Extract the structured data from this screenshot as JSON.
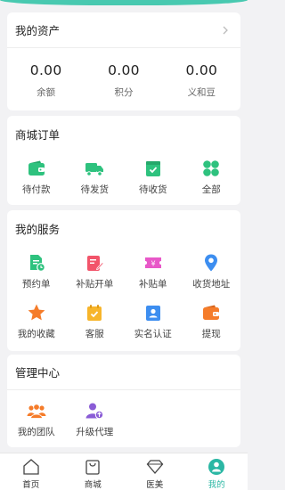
{
  "assets": {
    "title": "我的资产",
    "items": [
      {
        "value": "0.00",
        "label": "余额"
      },
      {
        "value": "0.00",
        "label": "积分"
      },
      {
        "value": "0.00",
        "label": "义和豆"
      }
    ]
  },
  "orders": {
    "title": "商城订单",
    "items": [
      {
        "label": "待付款",
        "icon": "wallet-icon"
      },
      {
        "label": "待发货",
        "icon": "truck-icon"
      },
      {
        "label": "待收货",
        "icon": "receive-box-icon"
      },
      {
        "label": "全部",
        "icon": "all-grid-icon"
      }
    ]
  },
  "services": {
    "title": "我的服务",
    "items": [
      {
        "label": "预约单",
        "icon": "appointment-doc-icon"
      },
      {
        "label": "补贴开单",
        "icon": "subsidy-order-edit-icon"
      },
      {
        "label": "补贴单",
        "icon": "subsidy-ticket-icon"
      },
      {
        "label": "收货地址",
        "icon": "location-pin-icon"
      },
      {
        "label": "我的收藏",
        "icon": "star-icon"
      },
      {
        "label": "客服",
        "icon": "customer-service-icon"
      },
      {
        "label": "实名认证",
        "icon": "id-card-icon"
      },
      {
        "label": "提现",
        "icon": "withdraw-wallet-icon"
      }
    ]
  },
  "management": {
    "title": "管理中心",
    "items": [
      {
        "label": "我的团队",
        "icon": "team-icon"
      },
      {
        "label": "升级代理",
        "icon": "upgrade-agent-icon"
      }
    ]
  },
  "tabbar": {
    "active": "我的",
    "items": [
      {
        "label": "首页",
        "icon": "home-icon"
      },
      {
        "label": "商城",
        "icon": "shopping-bag-icon"
      },
      {
        "label": "医美",
        "icon": "diamond-icon"
      },
      {
        "label": "我的",
        "icon": "user-icon"
      }
    ]
  },
  "colors": {
    "accent": "#2bb7a4",
    "green": "#2ec27e",
    "red": "#f2546a",
    "pink": "#e858c8",
    "blue": "#3d8ef0",
    "orange": "#f57c2a",
    "yellow": "#f7b52b"
  }
}
